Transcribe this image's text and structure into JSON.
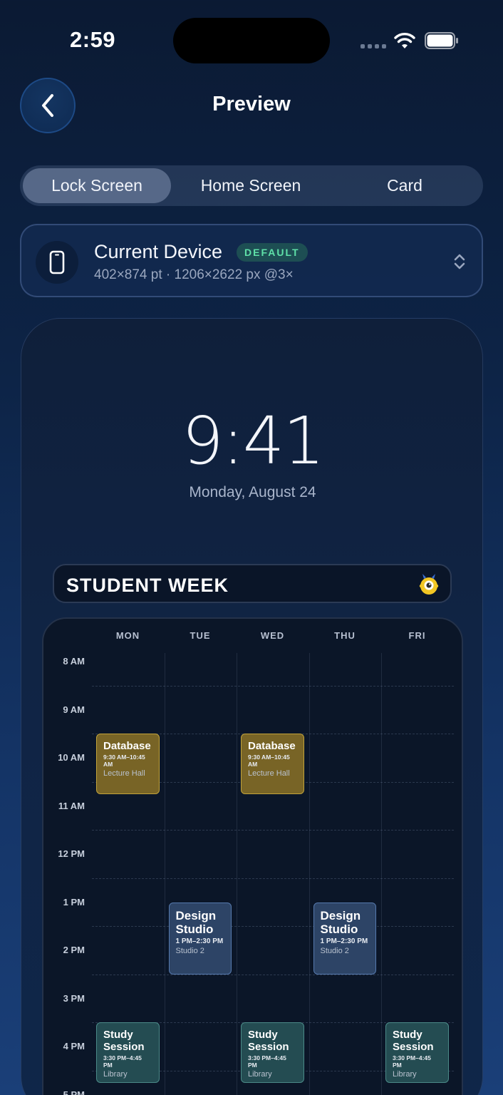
{
  "status_bar": {
    "time": "2:59"
  },
  "nav": {
    "title": "Preview"
  },
  "segments": [
    {
      "label": "Lock Screen",
      "active": true
    },
    {
      "label": "Home Screen",
      "active": false
    },
    {
      "label": "Card",
      "active": false
    }
  ],
  "device": {
    "name": "Current Device",
    "badge": "DEFAULT",
    "spec": "402×874 pt · 1206×2622 px @3×"
  },
  "lock_screen": {
    "time": "9:41",
    "date": "Monday, August 24"
  },
  "widget": {
    "title": "STUDENT WEEK",
    "days": [
      "MON",
      "TUE",
      "WED",
      "THU",
      "FRI"
    ],
    "hours": [
      "8 AM",
      "9 AM",
      "10 AM",
      "11 AM",
      "12 PM",
      "1 PM",
      "2 PM",
      "3 PM",
      "4 PM",
      "5 PM"
    ],
    "events": [
      {
        "title": "Database",
        "time": "9:30 AM–10:45 AM",
        "location": "Lecture Hall",
        "day": "MON",
        "color": "#786426"
      },
      {
        "title": "Database",
        "time": "9:30 AM–10:45 AM",
        "location": "Lecture Hall",
        "day": "WED",
        "color": "#786426"
      },
      {
        "title": "Design Studio",
        "time": "1 PM–2:30 PM",
        "location": "Studio 2",
        "day": "TUE",
        "color": "#2d4466"
      },
      {
        "title": "Design Studio",
        "time": "1 PM–2:30 PM",
        "location": "Studio 2",
        "day": "THU",
        "color": "#2d4466"
      },
      {
        "title": "Study Session",
        "time": "3:30 PM–4:45 PM",
        "location": "Library",
        "day": "MON",
        "color": "#244c52"
      },
      {
        "title": "Study Session",
        "time": "3:30 PM–4:45 PM",
        "location": "Library",
        "day": "WED",
        "color": "#244c52"
      },
      {
        "title": "Study Session",
        "time": "3:30 PM–4:45 PM",
        "location": "Library",
        "day": "FRI",
        "color": "#244c52"
      }
    ]
  },
  "icons": {
    "back": "chevron-left-icon",
    "device": "phone-icon",
    "selector": "chevron-up-down-icon",
    "wifi": "wifi-icon",
    "battery": "battery-icon",
    "signal": "cellular-signal-icon",
    "mascot": "monster-mascot-icon"
  },
  "colors": {
    "badge_text": "#5fe0a8",
    "database_event": "#786426",
    "design_event": "#2d4466",
    "study_event": "#244c52"
  }
}
